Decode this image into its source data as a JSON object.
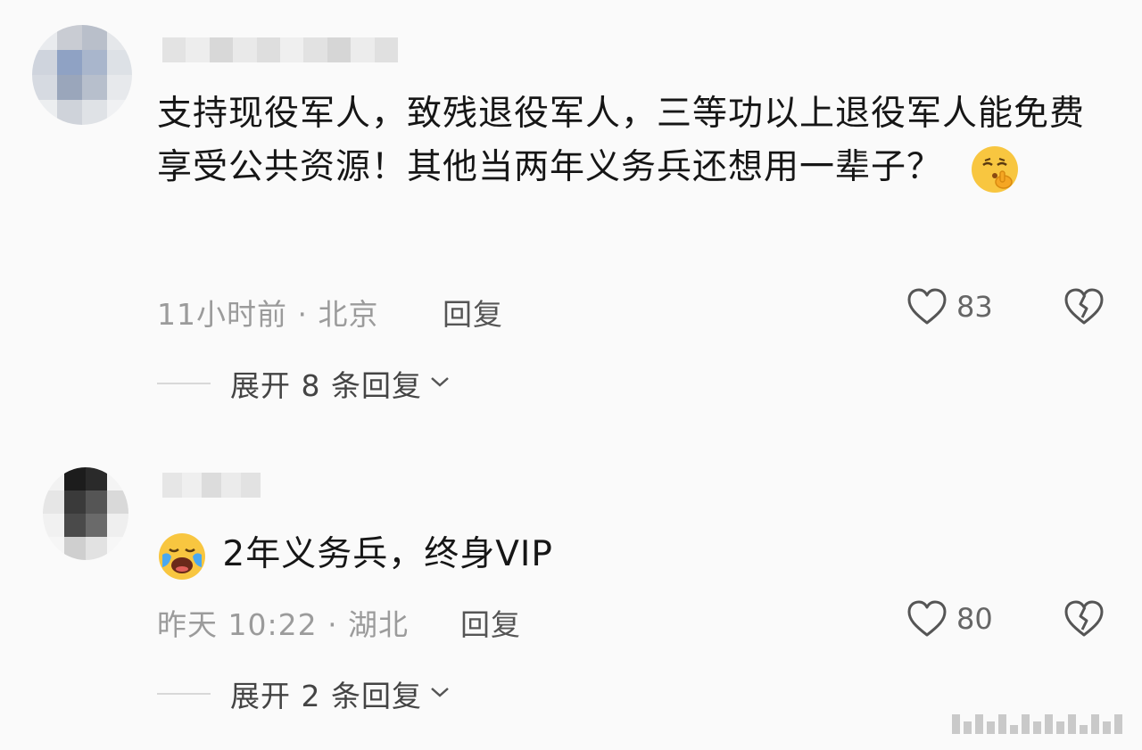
{
  "comments": [
    {
      "avatar_colors": [
        "#e9ebee",
        "#c9ccd3",
        "#b9bfca",
        "#e5e7ea",
        "#cfd4dd",
        "#8fa2c4",
        "#a9b6cc",
        "#dde1e6",
        "#d6dae1",
        "#9aa6bb",
        "#b7bfcc",
        "#e7e9ec",
        "#eceef0",
        "#cfd3da",
        "#dfe2e6",
        "#f0f1f3"
      ],
      "username_blocks": [
        "#e3e3e3",
        "#ededed",
        "#d8d8d8",
        "#e9e9e9",
        "#dedede",
        "#efefef",
        "#e2e2e2",
        "#d6d6d6",
        "#ececec",
        "#e0e0e0"
      ],
      "text": "支持现役军人，致残退役军人，三等功以上退役军人能免费享受公共资源！其他当两年义务兵还想用一辈子？",
      "emoji": "shushing-face",
      "time_location": "11小时前 · 北京",
      "reply_label": "回复",
      "likes": "83",
      "expand_label": "展开 8 条回复"
    },
    {
      "avatar_colors": [
        "#f2f2f2",
        "#1c1c1c",
        "#2a2a2a",
        "#f4f4f4",
        "#e6e6e6",
        "#3a3a3a",
        "#555555",
        "#d9d9d9",
        "#f1f1f1",
        "#4a4a4a",
        "#6a6a6a",
        "#efefef",
        "#f6f6f6",
        "#cfcfcf",
        "#e2e2e2",
        "#f7f7f7"
      ],
      "username_blocks": [
        "#e6e6e6",
        "#efefef",
        "#dcdcdc",
        "#ebebeb",
        "#e2e2e2"
      ],
      "text": "2年义务兵，终身VIP",
      "emoji": "loudly-crying-face",
      "time_location": "昨天 10:22 · 湖北",
      "reply_label": "回复",
      "likes": "80",
      "expand_label": "展开 2 条回复"
    }
  ]
}
